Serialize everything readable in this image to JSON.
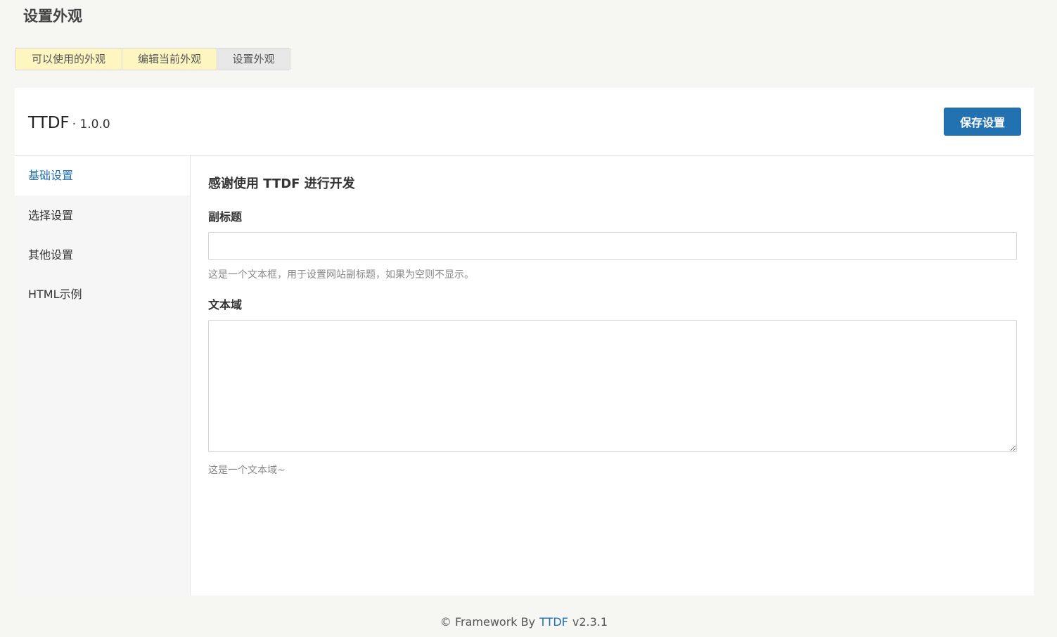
{
  "header": {
    "title": "设置外观"
  },
  "tabs": [
    {
      "label": "可以使用的外观"
    },
    {
      "label": "编辑当前外观"
    },
    {
      "label": "设置外观"
    }
  ],
  "theme": {
    "name": "TTDF",
    "version": "· 1.0.0"
  },
  "toolbar": {
    "save_label": "保存设置"
  },
  "sidebar": {
    "items": [
      {
        "label": "基础设置"
      },
      {
        "label": "选择设置"
      },
      {
        "label": "其他设置"
      },
      {
        "label": "HTML示例"
      }
    ]
  },
  "main": {
    "section_title": "感谢使用 TTDF 进行开发",
    "subtitle_field": {
      "label": "副标题",
      "value": "",
      "help": "这是一个文本框，用于设置网站副标题，如果为空则不显示。"
    },
    "textarea_field": {
      "label": "文本域",
      "value": "",
      "help": "这是一个文本域~"
    }
  },
  "footer": {
    "prefix": "© Framework By",
    "link_text": "TTDF",
    "version": "v2.3.1"
  },
  "colors": {
    "accent": "#2271b1",
    "tab_highlight": "#fdf6c0",
    "page_background": "#f6f6f3"
  }
}
